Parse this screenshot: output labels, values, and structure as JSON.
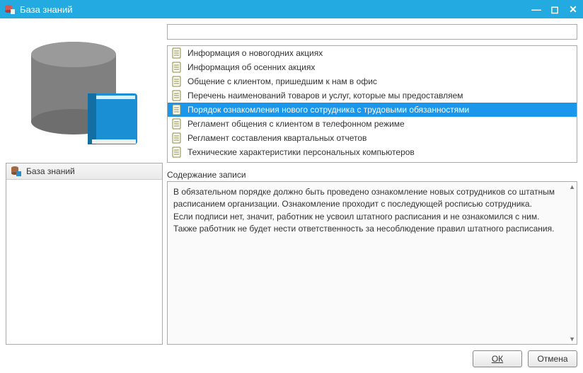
{
  "window": {
    "title": "База знаний"
  },
  "sidebar": {
    "root_label": "База знаний"
  },
  "search": {
    "value": ""
  },
  "articles": [
    {
      "title": "Информация о новогодних акциях",
      "selected": false
    },
    {
      "title": "Информация об осенних акциях",
      "selected": false
    },
    {
      "title": "Общение с клиентом, пришедшим к нам в офис",
      "selected": false
    },
    {
      "title": "Перечень наименований товаров и услуг, которые мы предоставляем",
      "selected": false
    },
    {
      "title": "Порядок ознакомления нового сотрудника с трудовыми обязанностями",
      "selected": true
    },
    {
      "title": "Регламент общения с клиентом в телефонном режиме",
      "selected": false
    },
    {
      "title": "Регламент составления квартальных отчетов",
      "selected": false
    },
    {
      "title": "Технические характеристики персональных компьютеров",
      "selected": false
    }
  ],
  "detail": {
    "section_label": "Содержание записи",
    "body": "В обязательном порядке должно быть проведено ознакомление новых сотрудников со штатным расписанием организации. Ознакомление проходит с последующей росписью сотрудника.\nЕсли подписи нет, значит, работник не усвоил штатного расписания и не ознакомился с ним. Также работник не будет нести ответственность за несоблюдение правил штатного расписания."
  },
  "buttons": {
    "ok": "ОК",
    "cancel": "Отмена"
  }
}
